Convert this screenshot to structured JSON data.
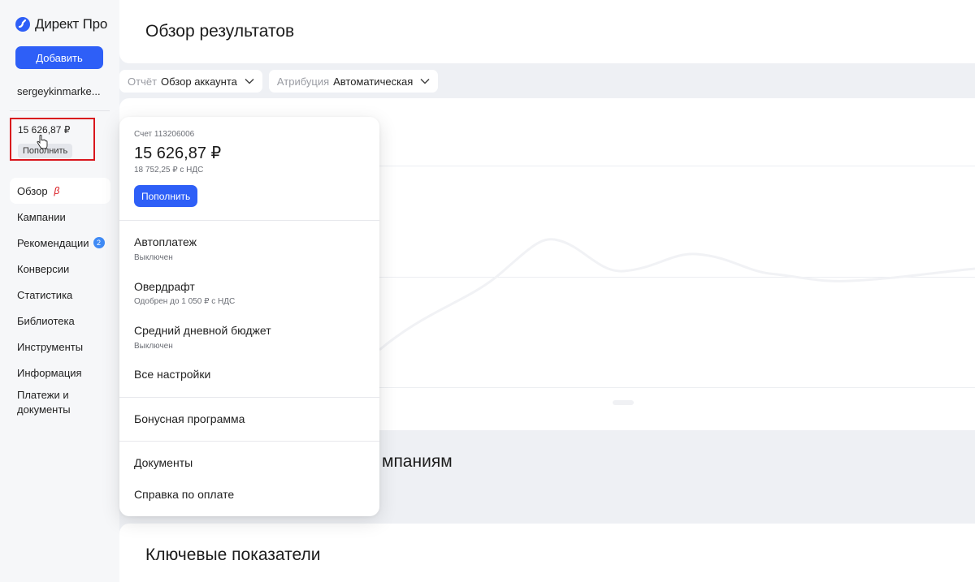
{
  "sidebar": {
    "logo_text": "Директ Про",
    "add_label": "Добавить",
    "account_login": "sergeykinmarke...",
    "balance": {
      "amount": "15 626,87 ₽",
      "topup_label": "Пополнить"
    },
    "nav": [
      {
        "label": "Обзор",
        "beta": "β"
      },
      {
        "label": "Кампании"
      },
      {
        "label": "Рекомендации",
        "badge": "2"
      },
      {
        "label": "Конверсии"
      },
      {
        "label": "Статистика"
      },
      {
        "label": "Библиотека"
      },
      {
        "label": "Инструменты"
      },
      {
        "label": "Информация"
      },
      {
        "label": "Платежи и документы"
      }
    ]
  },
  "header": {
    "title": "Обзор результатов"
  },
  "filters": {
    "report": {
      "label": "Отчёт",
      "value": "Обзор аккаунта"
    },
    "attribution": {
      "label": "Атрибуция",
      "value": "Автоматическая"
    }
  },
  "sections": {
    "campaigns_partial": "мпаниям",
    "kpi_title": "Ключевые показатели"
  },
  "popup": {
    "account_number": "Счет 113206006",
    "amount": "15 626,87 ₽",
    "amount_vat": "18 752,25 ₽ с НДС",
    "topup_label": "Пополнить",
    "autopay": {
      "label": "Автоплатеж",
      "status": "Выключен"
    },
    "overdraft": {
      "label": "Овердрафт",
      "status": "Одобрен до 1 050 ₽ с НДС"
    },
    "daily_budget": {
      "label": "Средний дневной бюджет",
      "status": "Выключен"
    },
    "all_settings": "Все настройки",
    "bonus": "Бонусная программа",
    "documents": "Документы",
    "payment_help": "Справка по оплате"
  },
  "colors": {
    "accent": "#2e5ff7",
    "highlight_box": "#d9161d",
    "badge": "#3f8af5"
  }
}
